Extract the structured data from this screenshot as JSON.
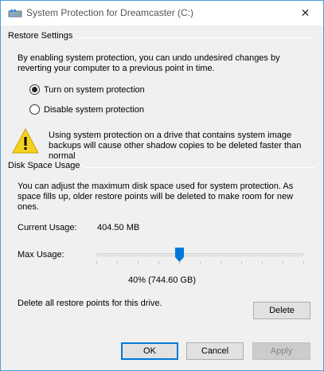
{
  "window": {
    "title": "System Protection for Dreamcaster (C:)",
    "close_symbol": "✕"
  },
  "restore_settings": {
    "group_label": "Restore Settings",
    "description_line1": "By enabling system protection, you can undo undesired changes by",
    "description_line2": "reverting your computer to a previous point in time.",
    "option_turn_on": "Turn on system protection",
    "option_disable": "Disable system protection",
    "selected": "turn_on",
    "warning_line1": "Using system protection on a drive that contains system image",
    "warning_line2": "backups will cause other shadow copies to be deleted faster than",
    "warning_line3": "normal"
  },
  "disk_space": {
    "group_label": "Disk Space Usage",
    "description_line1": "You can adjust the maximum disk space used for system protection. As",
    "description_line2": "space fills up, older restore points will be deleted to make room for new",
    "description_line3": "ones.",
    "current_usage_label": "Current Usage:",
    "current_usage_value": "404.50 MB",
    "max_usage_label": "Max Usage:",
    "max_usage_fraction": 0.4,
    "max_usage_readout": "40% (744.60 GB)",
    "delete_text": "Delete all restore points for this drive.",
    "delete_button": "Delete"
  },
  "footer": {
    "ok": "OK",
    "cancel": "Cancel",
    "apply": "Apply"
  },
  "colors": {
    "accent": "#0078d7",
    "warning_yellow": "#f7d21a",
    "window_border": "#4a9fd8"
  }
}
